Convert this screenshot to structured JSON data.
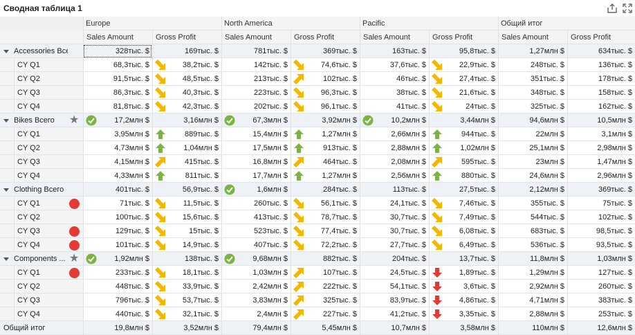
{
  "title": "Сводная таблица 1",
  "toolbar": {
    "export_icon": "export-icon",
    "expand_icon": "fullscreen-icon"
  },
  "colors": {
    "green": "#7cb342",
    "yellow": "#f5b800",
    "red": "#e53935",
    "star": "#777777",
    "header_bg": "#f4f4f4",
    "total_bg": "#eef1f5"
  },
  "columns": {
    "groups": [
      "Europe",
      "North America",
      "Pacific",
      "Общий итог"
    ],
    "measures": [
      "Sales Amount",
      "Gross Profit"
    ]
  },
  "rows": [
    {
      "label": "Accessories Всего",
      "type": "total",
      "flag": "",
      "cells": [
        {
          "s": "328тыс. $",
          "si": "",
          "g": "169тыс. $",
          "gi": ""
        },
        {
          "s": "781тыс. $",
          "si": "",
          "g": "369тыс. $",
          "gi": ""
        },
        {
          "s": "163тыс. $",
          "si": "",
          "g": "95,8тыс. $",
          "gi": ""
        },
        {
          "s": "1,27млн $",
          "si": "",
          "g": "634тыс. $",
          "gi": ""
        }
      ]
    },
    {
      "label": "CY Q1",
      "type": "child",
      "flag": "",
      "cells": [
        {
          "s": "68,3тыс. $",
          "si": "",
          "g": "38,2тыс. $",
          "gi": "down-right"
        },
        {
          "s": "142тыс. $",
          "si": "",
          "g": "74,6тыс. $",
          "gi": "down-right"
        },
        {
          "s": "37,6тыс. $",
          "si": "",
          "g": "22,9тыс. $",
          "gi": "down-right"
        },
        {
          "s": "248тыс. $",
          "si": "",
          "g": "136тыс. $",
          "gi": ""
        }
      ]
    },
    {
      "label": "CY Q2",
      "type": "child",
      "flag": "",
      "cells": [
        {
          "s": "91,5тыс. $",
          "si": "",
          "g": "48,5тыс. $",
          "gi": "down-right"
        },
        {
          "s": "213тыс. $",
          "si": "",
          "g": "102тыс. $",
          "gi": "up-right"
        },
        {
          "s": "46тыс. $",
          "si": "",
          "g": "27,4тыс. $",
          "gi": "down-right"
        },
        {
          "s": "351тыс. $",
          "si": "",
          "g": "178тыс. $",
          "gi": ""
        }
      ]
    },
    {
      "label": "CY Q3",
      "type": "child",
      "flag": "",
      "cells": [
        {
          "s": "86,3тыс. $",
          "si": "",
          "g": "40,3тыс. $",
          "gi": "down-right"
        },
        {
          "s": "223тыс. $",
          "si": "",
          "g": "96,3тыс. $",
          "gi": "down-right"
        },
        {
          "s": "38тыс. $",
          "si": "",
          "g": "21,6тыс. $",
          "gi": "down-right"
        },
        {
          "s": "348тыс. $",
          "si": "",
          "g": "158тыс. $",
          "gi": ""
        }
      ]
    },
    {
      "label": "CY Q4",
      "type": "child",
      "flag": "",
      "cells": [
        {
          "s": "81,8тыс. $",
          "si": "",
          "g": "42,3тыс. $",
          "gi": "down-right"
        },
        {
          "s": "202тыс. $",
          "si": "",
          "g": "96,1тыс. $",
          "gi": "down-right"
        },
        {
          "s": "41тыс. $",
          "si": "",
          "g": "24тыс. $",
          "gi": "down-right"
        },
        {
          "s": "325тыс. $",
          "si": "",
          "g": "162тыс. $",
          "gi": ""
        }
      ]
    },
    {
      "label": "Bikes Всего",
      "type": "total",
      "flag": "star",
      "cells": [
        {
          "s": "17,2млн $",
          "si": "check",
          "g": "3,16млн $",
          "gi": ""
        },
        {
          "s": "67,3млн $",
          "si": "check",
          "g": "3,92млн $",
          "gi": ""
        },
        {
          "s": "10,2млн $",
          "si": "check",
          "g": "3,44млн $",
          "gi": ""
        },
        {
          "s": "94,6млн $",
          "si": "",
          "g": "10,5млн $",
          "gi": ""
        }
      ]
    },
    {
      "label": "CY Q1",
      "type": "child",
      "flag": "",
      "cells": [
        {
          "s": "3,95млн $",
          "si": "",
          "g": "889тыс. $",
          "gi": "up"
        },
        {
          "s": "15,4млн $",
          "si": "",
          "g": "1,27млн $",
          "gi": "up"
        },
        {
          "s": "2,66млн $",
          "si": "",
          "g": "944тыс. $",
          "gi": "up"
        },
        {
          "s": "22млн $",
          "si": "",
          "g": "3,1млн $",
          "gi": ""
        }
      ]
    },
    {
      "label": "CY Q2",
      "type": "child",
      "flag": "",
      "cells": [
        {
          "s": "4,73млн $",
          "si": "",
          "g": "1,04млн $",
          "gi": "up"
        },
        {
          "s": "17,5млн $",
          "si": "",
          "g": "913тыс. $",
          "gi": "up"
        },
        {
          "s": "2,88млн $",
          "si": "",
          "g": "1,02млн $",
          "gi": "up"
        },
        {
          "s": "25,1млн $",
          "si": "",
          "g": "2,98млн $",
          "gi": ""
        }
      ]
    },
    {
      "label": "CY Q3",
      "type": "child",
      "flag": "",
      "cells": [
        {
          "s": "4,15млн $",
          "si": "",
          "g": "415тыс. $",
          "gi": "up-right"
        },
        {
          "s": "16,8млн $",
          "si": "",
          "g": "464тыс. $",
          "gi": "up-right"
        },
        {
          "s": "2,08млн $",
          "si": "",
          "g": "595тыс. $",
          "gi": "up-right"
        },
        {
          "s": "23млн $",
          "si": "",
          "g": "1,47млн $",
          "gi": ""
        }
      ]
    },
    {
      "label": "CY Q4",
      "type": "child",
      "flag": "",
      "cells": [
        {
          "s": "4,33млн $",
          "si": "",
          "g": "811тыс. $",
          "gi": "up"
        },
        {
          "s": "17,7млн $",
          "si": "",
          "g": "1,27млн $",
          "gi": "up"
        },
        {
          "s": "2,56млн $",
          "si": "",
          "g": "880тыс. $",
          "gi": "up"
        },
        {
          "s": "24,6млн $",
          "si": "",
          "g": "2,96млн $",
          "gi": ""
        }
      ]
    },
    {
      "label": "Clothing Всего",
      "type": "total",
      "flag": "",
      "cells": [
        {
          "s": "401тыс. $",
          "si": "",
          "g": "56,9тыс. $",
          "gi": ""
        },
        {
          "s": "1,6млн $",
          "si": "check",
          "g": "284тыс. $",
          "gi": ""
        },
        {
          "s": "113тыс. $",
          "si": "",
          "g": "27,5тыс. $",
          "gi": ""
        },
        {
          "s": "2,12млн $",
          "si": "",
          "g": "369тыс. $",
          "gi": ""
        }
      ]
    },
    {
      "label": "CY Q1",
      "type": "child",
      "flag": "circle",
      "cells": [
        {
          "s": "71тыс. $",
          "si": "",
          "g": "11,5тыс. $",
          "gi": "down-right"
        },
        {
          "s": "260тыс. $",
          "si": "",
          "g": "56,1тыс. $",
          "gi": "down-right"
        },
        {
          "s": "24,1тыс. $",
          "si": "",
          "g": "7,46тыс. $",
          "gi": "down-right"
        },
        {
          "s": "355тыс. $",
          "si": "",
          "g": "75тыс. $",
          "gi": ""
        }
      ]
    },
    {
      "label": "CY Q2",
      "type": "child",
      "flag": "",
      "cells": [
        {
          "s": "100тыс. $",
          "si": "",
          "g": "15,6тыс. $",
          "gi": "down-right"
        },
        {
          "s": "413тыс. $",
          "si": "",
          "g": "78,7тыс. $",
          "gi": "down-right"
        },
        {
          "s": "30,7тыс. $",
          "si": "",
          "g": "7,49тыс. $",
          "gi": "down-right"
        },
        {
          "s": "544тыс. $",
          "si": "",
          "g": "102тыс. $",
          "gi": ""
        }
      ]
    },
    {
      "label": "CY Q3",
      "type": "child",
      "flag": "circle",
      "cells": [
        {
          "s": "129тыс. $",
          "si": "",
          "g": "15тыс. $",
          "gi": "down-right"
        },
        {
          "s": "523тыс. $",
          "si": "",
          "g": "77,4тыс. $",
          "gi": "down-right"
        },
        {
          "s": "30,7тыс. $",
          "si": "",
          "g": "6,08тыс. $",
          "gi": "down-right"
        },
        {
          "s": "683тыс. $",
          "si": "",
          "g": "98,5тыс. $",
          "gi": ""
        }
      ]
    },
    {
      "label": "CY Q4",
      "type": "child",
      "flag": "circle",
      "cells": [
        {
          "s": "101тыс. $",
          "si": "",
          "g": "14,9тыс. $",
          "gi": "down-right"
        },
        {
          "s": "407тыс. $",
          "si": "",
          "g": "72,2тыс. $",
          "gi": "down-right"
        },
        {
          "s": "27,7тыс. $",
          "si": "",
          "g": "6,49тыс. $",
          "gi": "down-right"
        },
        {
          "s": "536тыс. $",
          "si": "",
          "g": "93,5тыс. $",
          "gi": ""
        }
      ]
    },
    {
      "label": "Components ...",
      "type": "total",
      "flag": "star",
      "cells": [
        {
          "s": "1,92млн $",
          "si": "check",
          "g": "138тыс. $",
          "gi": ""
        },
        {
          "s": "9,68млн $",
          "si": "check",
          "g": "882тыс. $",
          "gi": ""
        },
        {
          "s": "204тыс. $",
          "si": "",
          "g": "13,7тыс. $",
          "gi": ""
        },
        {
          "s": "11,8млн $",
          "si": "",
          "g": "1,03млн $",
          "gi": ""
        }
      ]
    },
    {
      "label": "CY Q1",
      "type": "child",
      "flag": "circle",
      "cells": [
        {
          "s": "233тыс. $",
          "si": "",
          "g": "18,1тыс. $",
          "gi": "down-right"
        },
        {
          "s": "1,03млн $",
          "si": "",
          "g": "107тыс. $",
          "gi": "up-right"
        },
        {
          "s": "24,5тыс. $",
          "si": "",
          "g": "1,89тыс. $",
          "gi": "down"
        },
        {
          "s": "1,29млн $",
          "si": "",
          "g": "127тыс. $",
          "gi": ""
        }
      ]
    },
    {
      "label": "CY Q2",
      "type": "child",
      "flag": "",
      "cells": [
        {
          "s": "448тыс. $",
          "si": "",
          "g": "33,9тыс. $",
          "gi": "down-right"
        },
        {
          "s": "2,42млн $",
          "si": "",
          "g": "222тыс. $",
          "gi": "up-right"
        },
        {
          "s": "54,1тыс. $",
          "si": "",
          "g": "3,6тыс. $",
          "gi": "down"
        },
        {
          "s": "2,92млн $",
          "si": "",
          "g": "260тыс. $",
          "gi": ""
        }
      ]
    },
    {
      "label": "CY Q3",
      "type": "child",
      "flag": "",
      "cells": [
        {
          "s": "796тыс. $",
          "si": "",
          "g": "53,7тыс. $",
          "gi": "down-right"
        },
        {
          "s": "3,83млн $",
          "si": "",
          "g": "325тыс. $",
          "gi": "up-right"
        },
        {
          "s": "83,9тыс. $",
          "si": "",
          "g": "4,86тыс. $",
          "gi": "down"
        },
        {
          "s": "4,71млн $",
          "si": "",
          "g": "383тыс. $",
          "gi": ""
        }
      ]
    },
    {
      "label": "CY Q4",
      "type": "child",
      "flag": "",
      "cells": [
        {
          "s": "440тыс. $",
          "si": "",
          "g": "32,1тыс. $",
          "gi": "down-right"
        },
        {
          "s": "2,4млн $",
          "si": "",
          "g": "227тыс. $",
          "gi": "up-right"
        },
        {
          "s": "41,2тыс. $",
          "si": "",
          "g": "3,35тыс. $",
          "gi": "down"
        },
        {
          "s": "2,88млн $",
          "si": "",
          "g": "253тыс. $",
          "gi": ""
        }
      ]
    },
    {
      "label": "Общий итог",
      "type": "grand",
      "flag": "",
      "cells": [
        {
          "s": "19,8млн $",
          "si": "",
          "g": "3,52млн $",
          "gi": ""
        },
        {
          "s": "79,4млн $",
          "si": "",
          "g": "5,45млн $",
          "gi": ""
        },
        {
          "s": "10,7млн $",
          "si": "",
          "g": "3,58млн $",
          "gi": ""
        },
        {
          "s": "110млн $",
          "si": "",
          "g": "12,6млн $",
          "gi": ""
        }
      ]
    }
  ]
}
